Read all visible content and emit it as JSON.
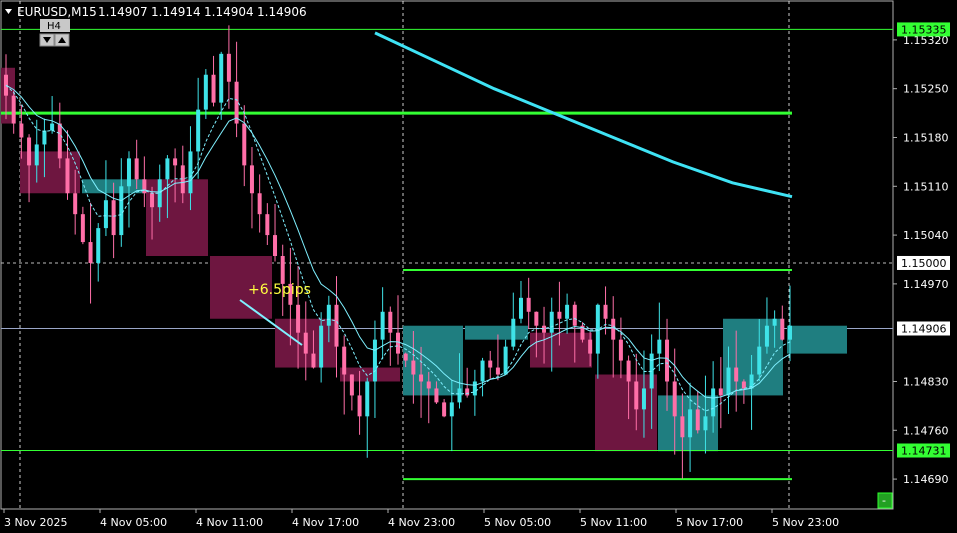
{
  "header": {
    "symbol": "EURUSD,M15",
    "open": "1.14907",
    "high": "1.14914",
    "low": "1.14904",
    "close": "1.14906"
  },
  "timeframe_label": "H4",
  "annotation": "+6.5pips",
  "colors": {
    "background": "#000000",
    "bull_candle": "#3FE3E8",
    "bear_candle": "#FF6FA8",
    "htf_bull_box": "#1F7E80",
    "htf_bear_box": "#6E1640",
    "level_line": "#33FF33",
    "fast_ma": "#7FF0FF",
    "slow_ma": "#3FE3F5",
    "grid": "#FFFFFF",
    "price_tag_level": "#33FF33",
    "price_tag_current": "#FFFFFF"
  },
  "price_axis": {
    "min": 1.1466,
    "max": 1.1536,
    "ticks": [
      "1.15320",
      "1.15250",
      "1.15180",
      "1.15110",
      "1.15040",
      "1.14970",
      "1.14830",
      "1.14760",
      "1.14690"
    ],
    "tags": [
      {
        "value": "1.15335",
        "price": 1.15335,
        "style": "level"
      },
      {
        "value": "1.15000",
        "price": 1.15,
        "style": "current"
      },
      {
        "value": "1.14906",
        "price": 1.14906,
        "style": "current"
      },
      {
        "value": "1.14731",
        "price": 1.14731,
        "style": "level"
      }
    ]
  },
  "time_axis": {
    "labels": [
      "3 Nov 2025",
      "4 Nov 05:00",
      "4 Nov 11:00",
      "4 Nov 17:00",
      "4 Nov 23:00",
      "5 Nov 05:00",
      "5 Nov 11:00",
      "5 Nov 17:00",
      "5 Nov 23:00"
    ]
  },
  "chart_data": {
    "type": "candlestick",
    "symbol": "EURUSD",
    "timeframe": "M15",
    "horizontal_levels": [
      1.15335,
      1.15215,
      1.1499,
      1.14731,
      1.1469
    ],
    "htf_boxes": [
      {
        "open": 1.1516,
        "close": 1.151,
        "dir": "bear"
      },
      {
        "open": 1.151,
        "close": 1.1512,
        "dir": "bull"
      },
      {
        "open": 1.1512,
        "close": 1.1501,
        "dir": "bear"
      },
      {
        "open": 1.1501,
        "close": 1.1492,
        "dir": "bear"
      },
      {
        "open": 1.1492,
        "close": 1.1485,
        "dir": "bear"
      },
      {
        "open": 1.1485,
        "close": 1.1483,
        "dir": "bear"
      },
      {
        "open": 1.1481,
        "close": 1.1491,
        "dir": "bull"
      },
      {
        "open": 1.1491,
        "close": 1.1489,
        "dir": "bull"
      },
      {
        "open": 1.149,
        "close": 1.1485,
        "dir": "bear"
      },
      {
        "open": 1.1484,
        "close": 1.1473,
        "dir": "bear"
      },
      {
        "open": 1.1473,
        "close": 1.1481,
        "dir": "bull"
      },
      {
        "open": 1.1481,
        "close": 1.1492,
        "dir": "bull"
      },
      {
        "open": 1.1491,
        "close": 1.1487,
        "dir": "bull"
      }
    ],
    "candles_close": [
      1.1524,
      1.152,
      1.1518,
      1.1514,
      1.1517,
      1.1519,
      1.152,
      1.1515,
      1.151,
      1.1507,
      1.1503,
      1.15,
      1.1505,
      1.1509,
      1.1504,
      1.1511,
      1.1515,
      1.1512,
      1.151,
      1.1508,
      1.1512,
      1.1515,
      1.1514,
      1.151,
      1.1516,
      1.1522,
      1.1527,
      1.1523,
      1.153,
      1.1526,
      1.152,
      1.1514,
      1.151,
      1.1507,
      1.1504,
      1.1501,
      1.1497,
      1.1494,
      1.149,
      1.1487,
      1.1485,
      1.1491,
      1.1494,
      1.1488,
      1.1484,
      1.1481,
      1.1478,
      1.1483,
      1.1489,
      1.1493,
      1.149,
      1.1487,
      1.1486,
      1.1484,
      1.1483,
      1.1482,
      1.148,
      1.1478,
      1.148,
      1.1482,
      1.1481,
      1.1483,
      1.1486,
      1.1485,
      1.1484,
      1.1488,
      1.1492,
      1.1495,
      1.1493,
      1.1491,
      1.149,
      1.1493,
      1.1492,
      1.1494,
      1.1491,
      1.1489,
      1.1487,
      1.1494,
      1.1492,
      1.1489,
      1.1486,
      1.1483,
      1.1479,
      1.1482,
      1.1487,
      1.1489,
      1.1483,
      1.1478,
      1.1475,
      1.1479,
      1.1476,
      1.1478,
      1.1482,
      1.1481,
      1.1485,
      1.1483,
      1.1482,
      1.1484,
      1.1488,
      1.1491,
      1.1492,
      1.1489,
      1.1491
    ],
    "slow_ma": [
      1.1533,
      1.1529,
      1.1525,
      1.15215,
      1.1518,
      1.15145,
      1.15115,
      1.15095
    ]
  }
}
